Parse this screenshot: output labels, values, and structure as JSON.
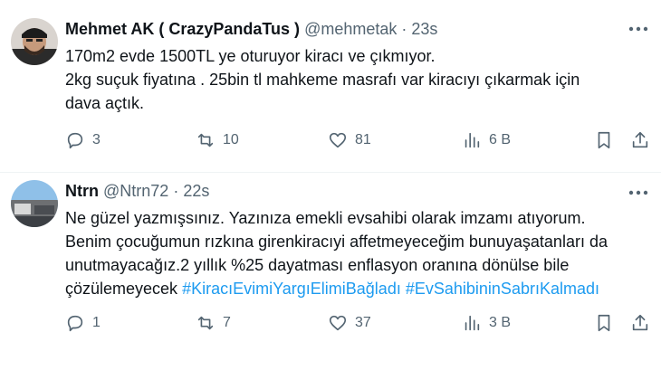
{
  "tweets": [
    {
      "name": "Mehmet AK ( CrazyPandaTus )",
      "handle": "@mehmetak",
      "separator": "·",
      "time": "23s",
      "lines": [
        "170m2 evde 1500TL ye oturuyor kiracı ve çıkmıyor.",
        "2kg suçuk fiyatına . 25bin tl mahkeme masrafı var kiracıyı çıkarmak için",
        "dava açtık."
      ],
      "replies": "3",
      "retweets": "10",
      "likes": "81",
      "views": "6 B"
    },
    {
      "name": "Ntrn",
      "handle": "@Ntrn72",
      "separator": "·",
      "time": "22s",
      "lines": [
        "Ne güzel yazmışsınız. Yazınıza emekli evsahibi olarak imzamı atıyorum.",
        "Benim çocuğumun rızkına girenkiracıyi affetmeyeceğim bunuyaşatanları da",
        "unutmayacağız.2 yıllık %25 dayatması enflasyon oranına dönülse bile"
      ],
      "last_line_text": "çözülemeyecek",
      "hashtag1": "#KiracıEvimiYargıElimiBağladı",
      "hashtag2": "#EvSahibininSabrıKalmadı",
      "replies": "1",
      "retweets": "7",
      "likes": "37",
      "views": "3 B"
    }
  ],
  "colors": {
    "text": "#0f1419",
    "muted": "#536471",
    "link": "#1d9bf0",
    "divider": "#eff3f4"
  },
  "icons": [
    "reply-icon",
    "retweet-icon",
    "like-icon",
    "views-icon",
    "bookmark-icon",
    "share-icon",
    "more-icon"
  ]
}
